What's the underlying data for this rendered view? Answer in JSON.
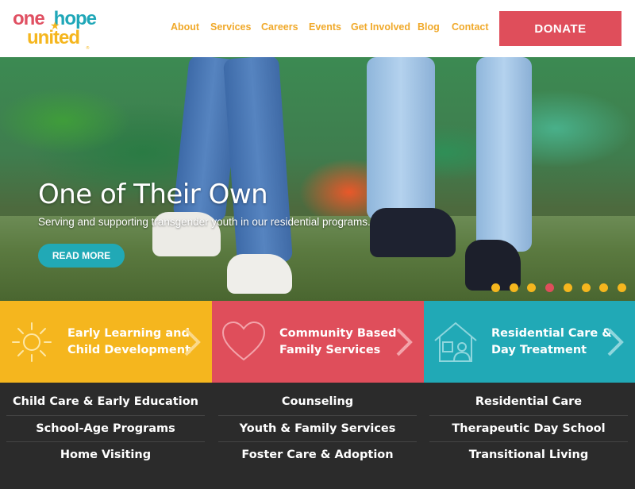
{
  "logo": {
    "line1_a": "one",
    "line1_b": "hope",
    "line2": "united",
    "trademark": "®"
  },
  "nav": {
    "items": [
      "About",
      "Services",
      "Careers",
      "Events",
      "Get Involved",
      "Blog",
      "Contact"
    ],
    "donate_label": "DONATE"
  },
  "hero": {
    "title": "One of Their Own",
    "subtitle": "Serving and supporting transgender youth in our residential programs.",
    "cta_label": "READ MORE",
    "slide_count": 8,
    "active_slide": 4
  },
  "tiles": [
    {
      "label": "Early Learning and\nChild Development",
      "icon": "sun-icon",
      "color": "#f5b61e"
    },
    {
      "label": "Community Based\nFamily Services",
      "icon": "heart-icon",
      "color": "#df4e5b"
    },
    {
      "label": "Residential Care &\nDay Treatment",
      "icon": "house-icon",
      "color": "#21a9b6"
    }
  ],
  "links": {
    "col1": [
      "Child Care & Early Education",
      "School-Age Programs",
      "Home Visiting"
    ],
    "col2": [
      "Counseling",
      "Youth & Family Services",
      "Foster Care & Adoption"
    ],
    "col3": [
      "Residential Care",
      "Therapeutic Day School",
      "Transitional Living"
    ]
  },
  "colors": {
    "yellow": "#f5b61e",
    "red": "#df4e5b",
    "teal": "#21a9b6",
    "dark": "#2b2b2b"
  }
}
